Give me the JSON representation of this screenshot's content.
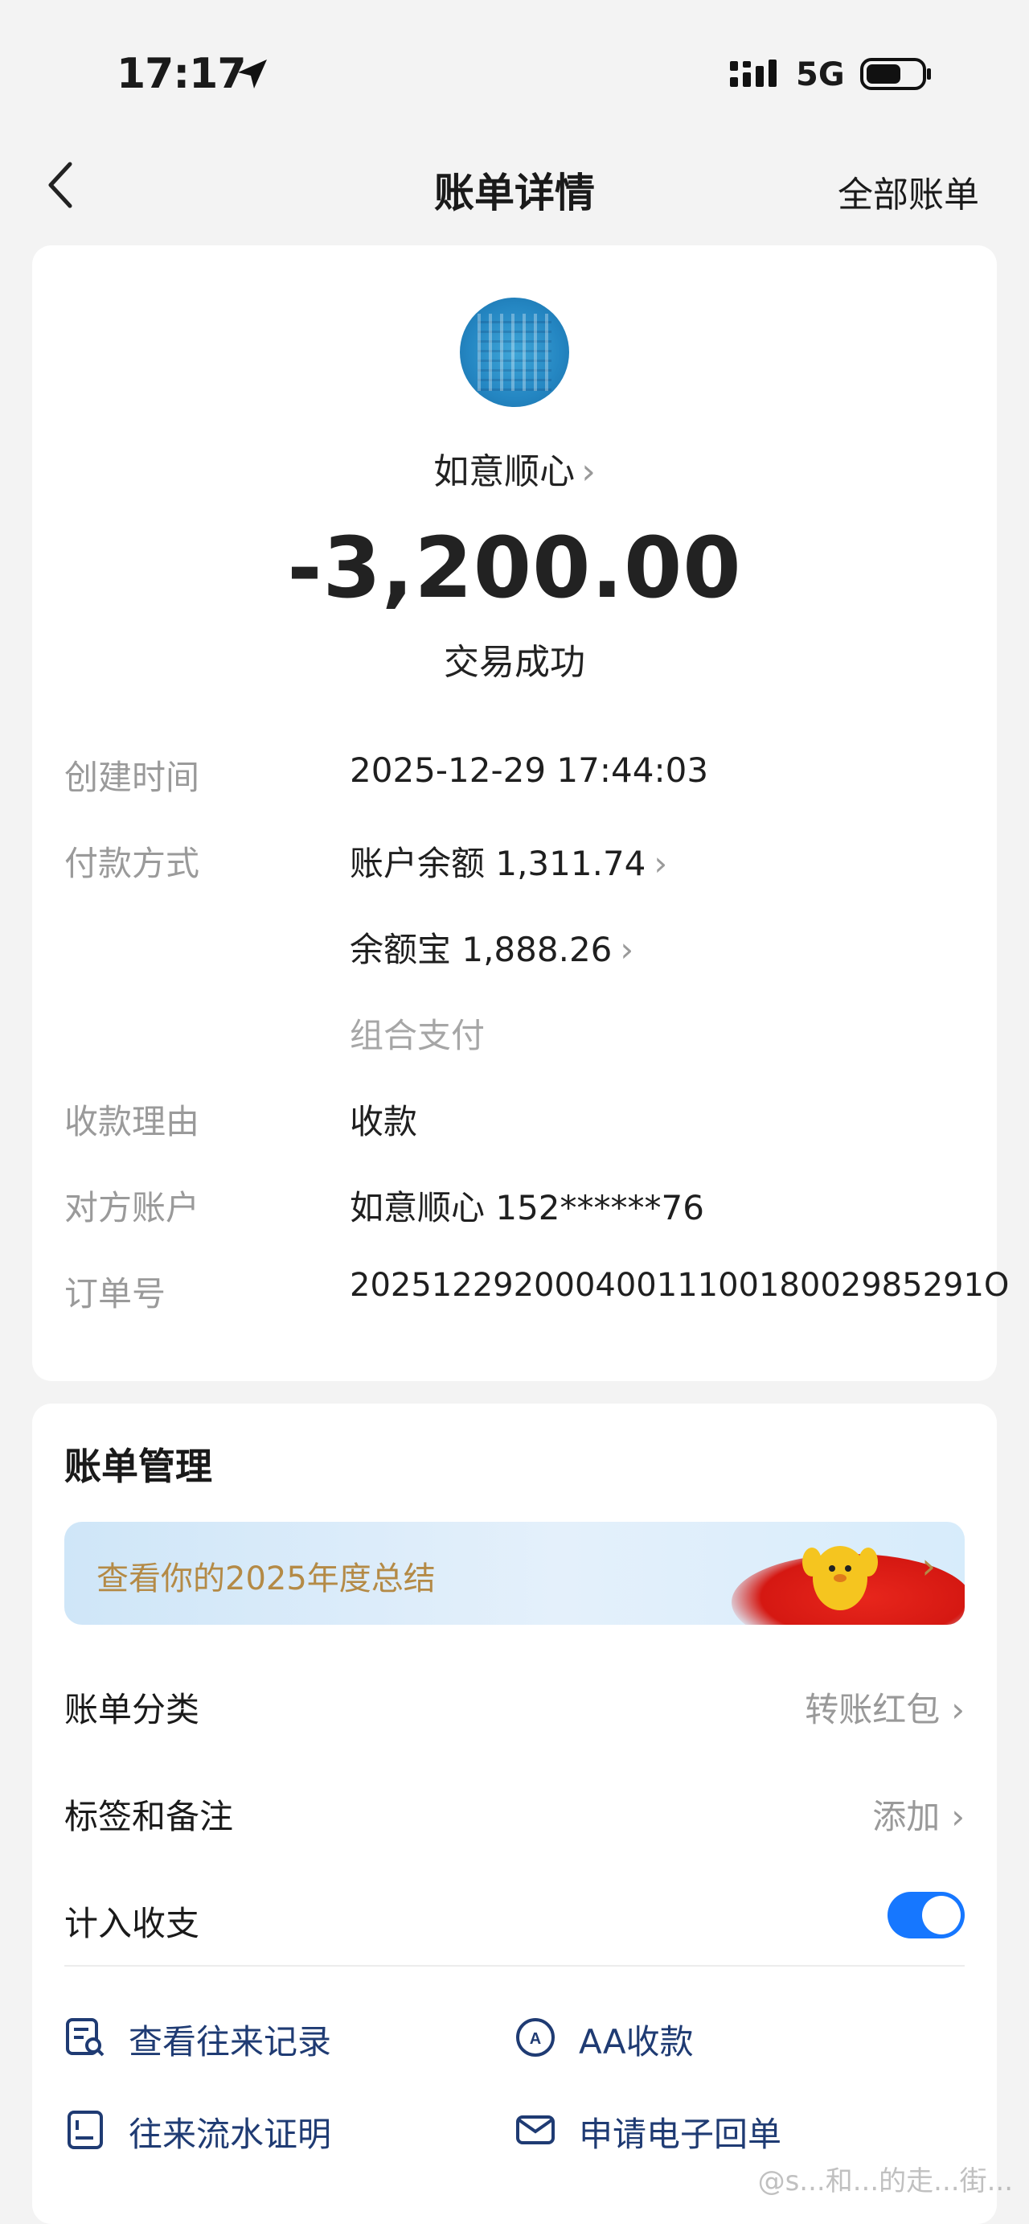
{
  "status_bar": {
    "time": "17:17",
    "network": "5G"
  },
  "nav": {
    "title": "账单详情",
    "right_link": "全部账单"
  },
  "detail": {
    "payee": "如意顺心",
    "amount": "-3,200.00",
    "status": "交易成功",
    "rows": [
      {
        "label": "创建时间",
        "value": "2025-12-29 17:44:03"
      },
      {
        "label": "付款方式",
        "value": "账户余额 1,311.74"
      },
      {
        "label": "",
        "value": "余额宝 1,888.26"
      },
      {
        "label": "",
        "value": "组合支付"
      },
      {
        "label": "收款理由",
        "value": "收款"
      },
      {
        "label": "对方账户",
        "value": "如意顺心 152******76"
      },
      {
        "label": "订单号",
        "value": "2025122920004001110018002985291О"
      }
    ]
  },
  "management": {
    "title": "账单管理",
    "banner_text": "查看你的2025年度总结",
    "category_label": "账单分类",
    "category_value": "转账红包",
    "tags_label": "标签和备注",
    "tags_value": "添加",
    "include_label": "计入收支",
    "include_on": true,
    "actions": [
      {
        "label": "查看往来记录",
        "icon": "record-search-icon"
      },
      {
        "label": "AA收款",
        "icon": "aa-icon"
      },
      {
        "label": "往来流水证明",
        "icon": "document-icon"
      },
      {
        "label": "申请电子回单",
        "icon": "mail-icon"
      }
    ]
  },
  "watermark": "@s...和...的走...街...",
  "colors": {
    "accent": "#1677ff",
    "banner_text": "#b48a46",
    "action_text": "#1f3b73"
  }
}
